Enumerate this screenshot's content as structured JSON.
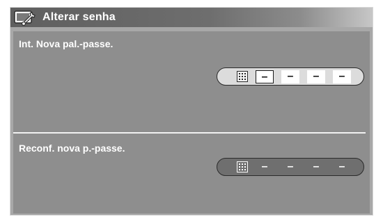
{
  "dialog": {
    "title": "Alterar senha",
    "icon": "tools-wrench-icon"
  },
  "new_password": {
    "label": "Int. Nova pal.-passe.",
    "keypad_icon": "keypad-icon",
    "digits": [
      "–",
      "–",
      "–",
      "–"
    ]
  },
  "confirm_password": {
    "label": "Reconf. nova p.-passe.",
    "keypad_icon": "keypad-icon",
    "digits": [
      "–",
      "–",
      "–",
      "–"
    ]
  }
}
